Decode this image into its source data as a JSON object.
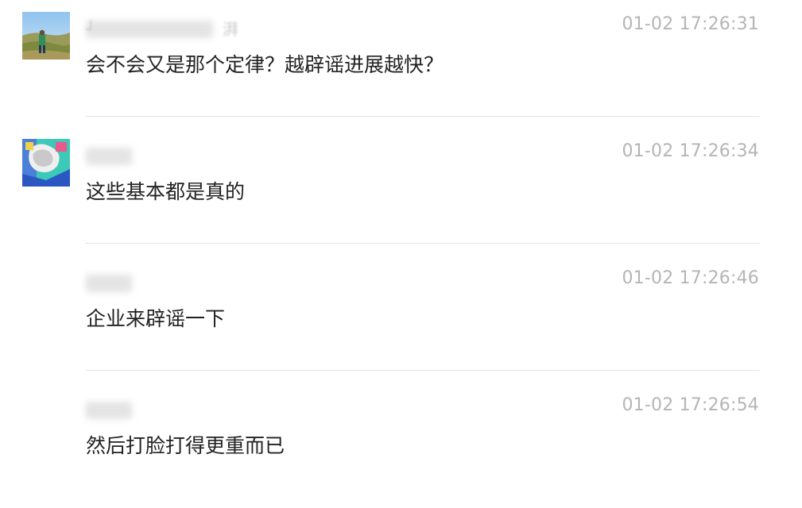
{
  "comments": [
    {
      "timestamp": "01-02 17:26:31",
      "text": "会不会又是那个定律？越辟谣进展越快？",
      "username_visible_fragment": "湃"
    },
    {
      "timestamp": "01-02 17:26:34",
      "text": "这些基本都是真的"
    },
    {
      "timestamp": "01-02 17:26:46",
      "text": "企业来辟谣一下"
    },
    {
      "timestamp": "01-02 17:26:54",
      "text": "然后打脸打得更重而已"
    }
  ]
}
